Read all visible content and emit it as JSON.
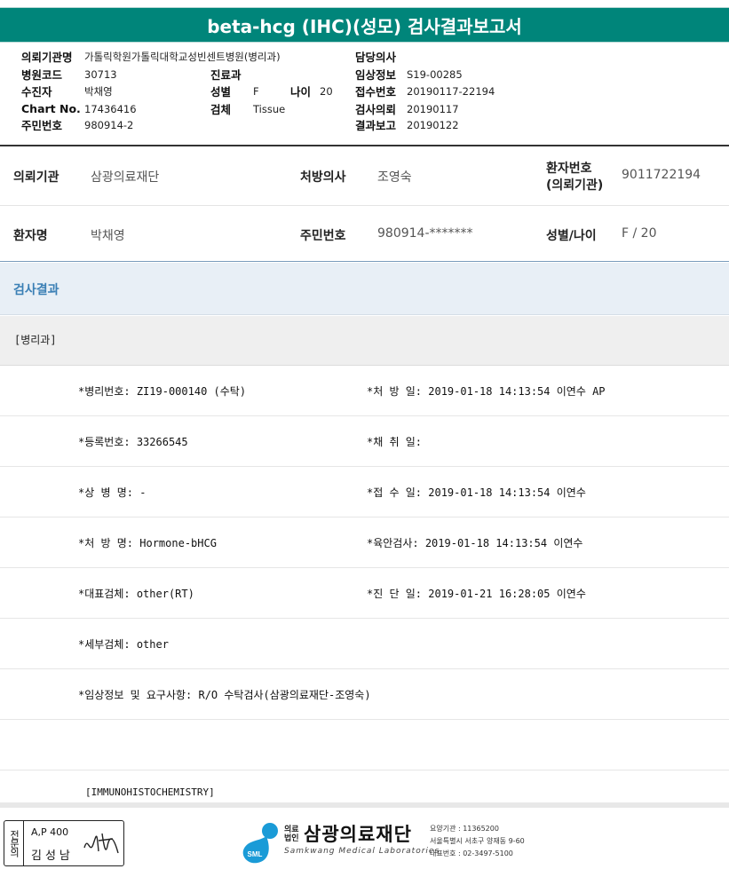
{
  "title": "beta-hcg (IHC)(성모) 검사결과보고서",
  "header": {
    "row1": {
      "l1": "의뢰기관명",
      "v1": "가톨릭학원가톨릭대학교성빈센트병원(병리과)",
      "l3": "담당의사",
      "v3": ""
    },
    "row2": {
      "l1": "병원코드",
      "v1": "30713",
      "l2": "진료과",
      "v2": "",
      "l3": "임상정보",
      "v3": "S19-00285"
    },
    "row3": {
      "l1": "수진자",
      "v1": "박채영",
      "l2": "성별",
      "v2": "F",
      "l2b": "나이",
      "v2b": "20",
      "l3": "접수번호",
      "v3": "20190117-22194"
    },
    "row4": {
      "l1": "Chart No.",
      "v1": "17436416",
      "l2": "검체",
      "v2": "Tissue",
      "l3": "검사의뢰",
      "v3": "20190117"
    },
    "row5": {
      "l1": "주민번호",
      "v1": "980914-2",
      "l3": "결과보고",
      "v3": "20190122"
    }
  },
  "info": {
    "institution_label": "의뢰기관",
    "institution_value": "삼광의료재단",
    "doctor_label": "처방의사",
    "doctor_value": "조영숙",
    "patient_no_label_1": "환자번호",
    "patient_no_label_2": "(의뢰기관)",
    "patient_no_value": "9011722194",
    "patient_name_label": "환자명",
    "patient_name_value": "박채영",
    "rrn_label": "주민번호",
    "rrn_value": "980914-*******",
    "sex_age_label": "성별/나이",
    "sex_age_value": "F / 20"
  },
  "results_title": "검사결과",
  "department": "[병리과]",
  "results": [
    {
      "left": "*병리번호: ZI19-000140 (수탁)",
      "right": "*처 방 일: 2019-01-18 14:13:54  이연수 AP"
    },
    {
      "left": "*등록번호: 33266545",
      "right": "*채 취 일:"
    },
    {
      "left": "*상 병 명: -",
      "right": "*접 수 일: 2019-01-18 14:13:54  이연수"
    },
    {
      "left": "*처 방 명: Hormone-bHCG",
      "right": "*육안검사: 2019-01-18 14:13:54  이연수"
    },
    {
      "left": "*대표검체: other(RT)",
      "right": "*진 단 일: 2019-01-21 16:28:05  이연수"
    },
    {
      "left": "*세부검체: other",
      "right": ""
    },
    {
      "left": "*임상정보 및 요구사항: R/O 수탁검사(삼광의료재단-조영숙)",
      "right": ""
    },
    {
      "left": "",
      "right": ""
    }
  ],
  "ihc_label": "[IMMUNOHISTOCHEMISTRY]",
  "footer": {
    "stamp_vertical": "전문의",
    "stamp_code": "A,P 400",
    "stamp_name": "김성남",
    "logo_small": "의료\n법인",
    "logo_name": "삼광의료재단",
    "logo_en": "Samkwang Medical Laboratories",
    "logo_badge": "SML",
    "contact_1": "요양기관 : 11365200",
    "contact_2": "서울특별시 서초구 양재동 9-60",
    "contact_3": "대표번호 : 02-3497-5100"
  },
  "colors": {
    "title_bg": "#00857a",
    "result_head_bg": "#e8eff6",
    "logo_blue": "#1a9bd7"
  }
}
